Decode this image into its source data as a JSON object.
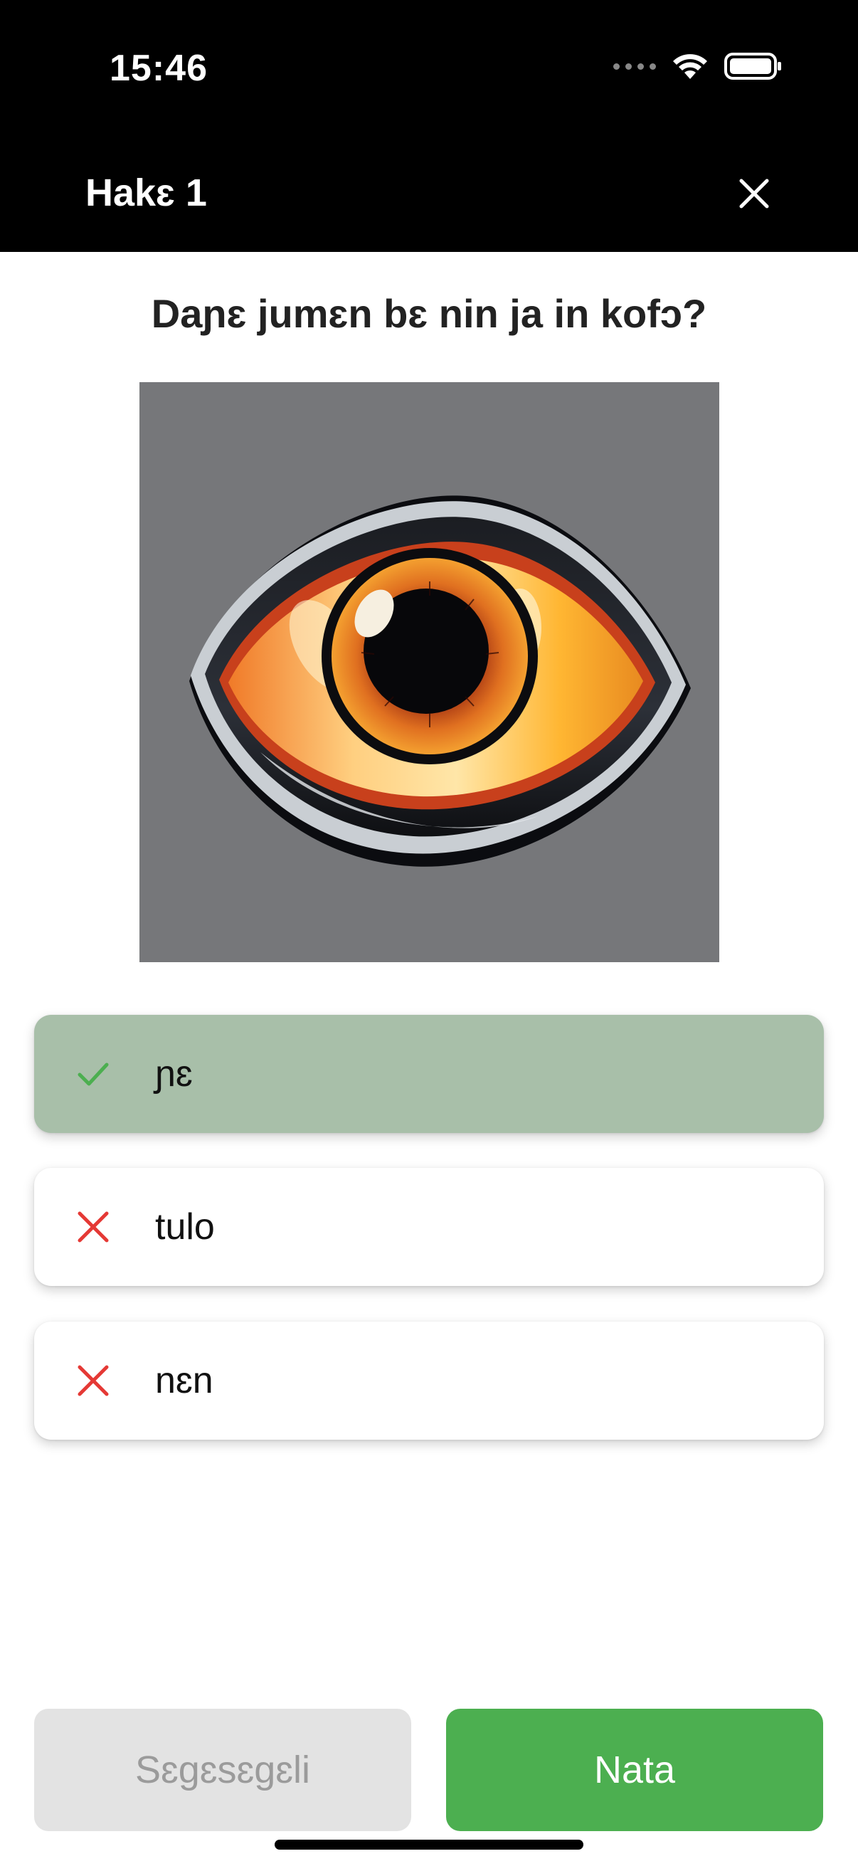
{
  "status_bar": {
    "time": "15:46"
  },
  "header": {
    "title": "Hakɛ 1"
  },
  "question": {
    "text": "Daɲɛ jumɛn bɛ nin ja in kofɔ?"
  },
  "image": {
    "subject": "eye"
  },
  "options": [
    {
      "label": "ɲɛ",
      "state": "correct",
      "icon": "check-icon"
    },
    {
      "label": "tulo",
      "state": "wrong",
      "icon": "close-icon"
    },
    {
      "label": "nɛn",
      "state": "wrong",
      "icon": "close-icon"
    }
  ],
  "buttons": {
    "secondary_label": "Sɛgɛsɛgɛli",
    "primary_label": "Nata"
  },
  "colors": {
    "header_bg": "#000000",
    "correct_bg": "#a8bfa9",
    "check": "#4caf50",
    "wrong": "#e53935",
    "primary": "#4caf50",
    "disabled_bg": "#e3e3e3",
    "image_bg": "#76777a"
  }
}
